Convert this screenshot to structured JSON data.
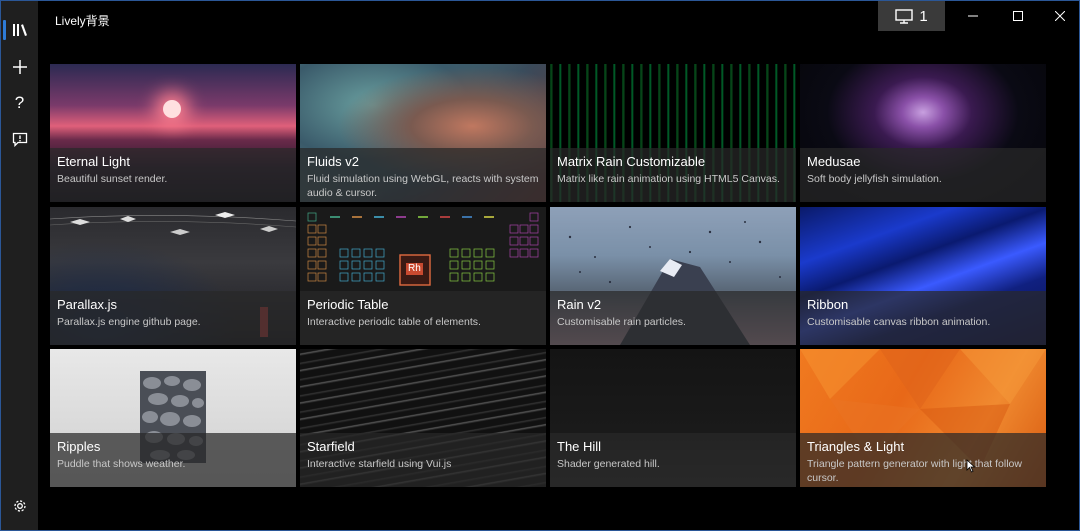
{
  "window": {
    "title": "Lively背景",
    "monitor_count": "1"
  },
  "sidebar": {
    "items": [
      {
        "name": "library",
        "icon": "library-icon",
        "active": true
      },
      {
        "name": "add",
        "icon": "plus-icon"
      },
      {
        "name": "help",
        "icon": "help-icon"
      },
      {
        "name": "feedback",
        "icon": "chat-icon"
      }
    ],
    "settings_icon": "gear-icon"
  },
  "wallpapers": [
    {
      "name": "Eternal Light",
      "desc": "Beautiful sunset render."
    },
    {
      "name": "Fluids v2",
      "desc": "Fluid simulation using WebGL, reacts with system audio & cursor."
    },
    {
      "name": "Matrix Rain Customizable",
      "desc": "Matrix like rain animation using HTML5 Canvas."
    },
    {
      "name": "Medusae",
      "desc": "Soft body jellyfish simulation."
    },
    {
      "name": "Parallax.js",
      "desc": "Parallax.js engine github page."
    },
    {
      "name": "Periodic Table",
      "desc": "Interactive periodic table of elements."
    },
    {
      "name": "Rain v2",
      "desc": "Customisable rain particles."
    },
    {
      "name": "Ribbon",
      "desc": "Customisable canvas ribbon animation."
    },
    {
      "name": "Ripples",
      "desc": "Puddle that shows weather."
    },
    {
      "name": "Starfield",
      "desc": "Interactive starfield using Vui.js"
    },
    {
      "name": "The Hill",
      "desc": "Shader generated hill."
    },
    {
      "name": "Triangles & Light",
      "desc": "Triangle pattern generator with light that follow cursor."
    }
  ],
  "periodic_symbol": "Rh",
  "colors": {
    "accent": "#2e7bd6",
    "selected_border": "#2e6bd0",
    "sidebar_bg": "#1f1f1f"
  }
}
